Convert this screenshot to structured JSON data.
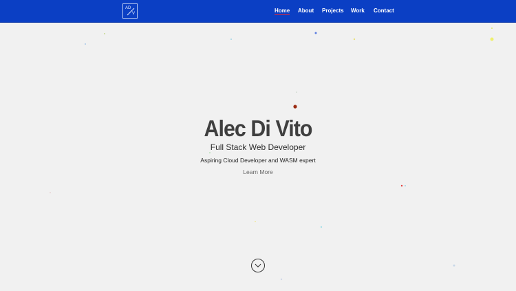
{
  "logo": {
    "line1": "AD",
    "line2": "V",
    "icon": "monogram-logo-icon"
  },
  "nav": {
    "items": [
      {
        "label": "Home",
        "active": true
      },
      {
        "label": "About",
        "active": false
      },
      {
        "label": "Projects",
        "active": false
      },
      {
        "label": "Work",
        "active": false
      },
      {
        "label": "Contact",
        "active": false
      }
    ],
    "active_underline_color": "#e0293a",
    "bar_color": "#0b3fc4"
  },
  "hero": {
    "name": "Alec Di  Vito",
    "title": "Full Stack Web Developer",
    "subtitle": "Aspiring Cloud Developer and WASM expert",
    "cta": "Learn More",
    "scroll_icon": "chevron-down-circle-icon"
  },
  "background": {
    "color": "#f1f1f1"
  }
}
